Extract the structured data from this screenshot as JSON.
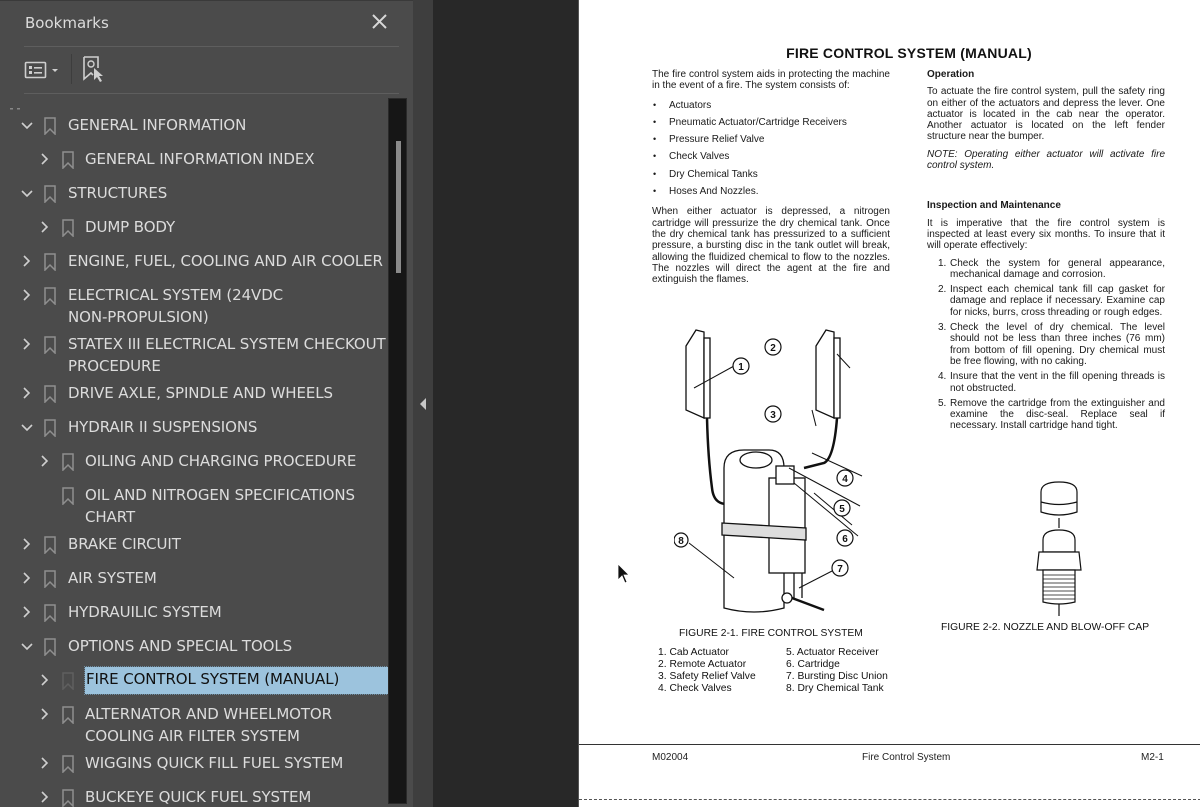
{
  "sidebar": {
    "title": "Bookmarks",
    "close_icon": "close-icon",
    "toolbar": {
      "options_icon": "options-list-icon",
      "new_bookmark_icon": "new-bookmark-icon"
    },
    "items": [
      {
        "label": "GENERAL INFORMATION",
        "level": 0,
        "expander": "expanded"
      },
      {
        "label": "GENERAL INFORMATION INDEX",
        "level": 1,
        "expander": "collapsed"
      },
      {
        "label": "STRUCTURES",
        "level": 0,
        "expander": "expanded"
      },
      {
        "label": "DUMP BODY",
        "level": 1,
        "expander": "collapsed"
      },
      {
        "label": "ENGINE, FUEL, COOLING AND AIR COOLER",
        "level": 0,
        "expander": "collapsed"
      },
      {
        "label": "ELECTRICAL SYSTEM (24VDC\nNON-PROPULSION)",
        "level": 0,
        "expander": "collapsed"
      },
      {
        "label": "STATEX III ELECTRICAL SYSTEM CHECKOUT\nPROCEDURE",
        "level": 0,
        "expander": "collapsed"
      },
      {
        "label": "DRIVE AXLE, SPINDLE AND WHEELS",
        "level": 0,
        "expander": "collapsed"
      },
      {
        "label": "HYDRAIR II SUSPENSIONS",
        "level": 0,
        "expander": "expanded"
      },
      {
        "label": "OILING AND CHARGING PROCEDURE",
        "level": 1,
        "expander": "collapsed"
      },
      {
        "label": "OIL AND NITROGEN SPECIFICATIONS\nCHART",
        "level": 1,
        "expander": "none"
      },
      {
        "label": "BRAKE CIRCUIT",
        "level": 0,
        "expander": "collapsed"
      },
      {
        "label": "AIR SYSTEM",
        "level": 0,
        "expander": "collapsed"
      },
      {
        "label": "HYDRAUILIC SYSTEM",
        "level": 0,
        "expander": "collapsed"
      },
      {
        "label": "OPTIONS AND SPECIAL TOOLS",
        "level": 0,
        "expander": "expanded"
      },
      {
        "label": "FIRE CONTROL SYSTEM (MANUAL)",
        "level": 1,
        "expander": "collapsed",
        "selected": true
      },
      {
        "label": "ALTERNATOR AND WHEELMOTOR\nCOOLING AIR FILTER SYSTEM",
        "level": 1,
        "expander": "collapsed"
      },
      {
        "label": "WIGGINS QUICK FILL FUEL SYSTEM",
        "level": 1,
        "expander": "collapsed"
      },
      {
        "label": "BUCKEYE QUICK FUEL SYSTEM",
        "level": 1,
        "expander": "collapsed"
      }
    ],
    "selection_color": "#9cc3dd"
  },
  "document": {
    "title": "FIRE CONTROL SYSTEM (MANUAL)",
    "intro": "The fire control system aids in protecting the machine in the event of a fire. The system consists of:",
    "components": [
      "Actuators",
      "Pneumatic Actuator/Cartridge Receivers",
      "Pressure Relief Valve",
      "Check Valves",
      "Dry Chemical Tanks",
      "Hoses And Nozzles."
    ],
    "description": "When either actuator is depressed, a nitrogen cartridge will pressurize the dry chemical tank. Once the dry chemical tank has pressurized to a sufficient pressure, a bursting disc in the tank outlet will break, allowing the fluidized chemical to flow to the nozzles. The nozzles will direct the agent at the fire and extinguish the flames.",
    "operation": {
      "heading": "Operation",
      "text": "To actuate the fire control system, pull the safety ring on either of the actuators and depress the lever. One actuator is located in the cab near the operator. Another actuator is located on the left fender structure near the bumper.",
      "note": "NOTE: Operating either actuator will activate fire control system."
    },
    "inspection": {
      "heading": "Inspection and Maintenance",
      "text": "It is imperative that the fire control system is inspected at least every six months. To insure that it will operate effectively:",
      "steps": [
        {
          "num": "1.",
          "text": "Check the system for general appearance, mechanical damage and corrosion."
        },
        {
          "num": "2.",
          "text": "Inspect each chemical tank fill cap gasket for damage and replace if necessary. Examine cap for nicks, burrs, cross threading or rough edges."
        },
        {
          "num": "3.",
          "text": "Check the level of dry chemical. The level should not be less than three inches (76 mm) from bottom of fill opening. Dry chemical must be free flowing, with no caking."
        },
        {
          "num": "4.",
          "text": "Insure that the vent in the fill opening threads is not obstructed."
        },
        {
          "num": "5.",
          "text": "Remove the cartridge from the extinguisher and examine the disc-seal. Replace seal if necessary. Install cartridge hand tight."
        }
      ]
    },
    "figure1": {
      "caption": "FIGURE 2-1. FIRE CONTROL SYSTEM",
      "callouts": [
        "1",
        "2",
        "3",
        "4",
        "4",
        "5",
        "6",
        "7",
        "8"
      ],
      "legend_col1": [
        "1. Cab Actuator",
        "2. Remote Actuator",
        "3. Safety Relief Valve",
        "4. Check Valves"
      ],
      "legend_col2": [
        "5. Actuator Receiver",
        "6. Cartridge",
        "7. Bursting Disc Union",
        "8. Dry Chemical Tank"
      ]
    },
    "figure2": {
      "caption": "FIGURE 2-2. NOZZLE AND BLOW-OFF CAP"
    },
    "footer": {
      "left": "M02004",
      "center": "Fire Control System",
      "right": "M2-1"
    }
  }
}
